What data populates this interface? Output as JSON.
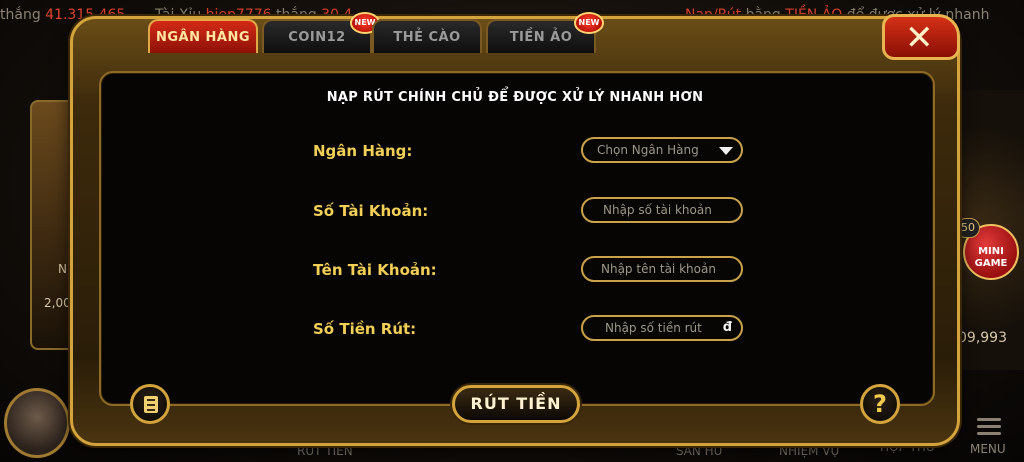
{
  "ticker": {
    "prefix_1": "thắng",
    "amount_1": "41.315.465",
    "game_2": "Tài Xỉu",
    "user_2": "hiep7776",
    "verb_2": "thắng",
    "amount_2": "30.4",
    "notice_a": "Nạp/Rút",
    "notice_b": "bằng",
    "notice_c": "TIỀN ẢO",
    "notice_d": "để được xử lý nhanh"
  },
  "background": {
    "left_card_label": "N",
    "left_card_value": "2,00",
    "mini_game_badge": "50",
    "mini_game_label": "MINI GAME",
    "right_money": "09,993",
    "bottom_items": [
      "RÚT TIỀN",
      "SĂN HŨ",
      "NHIỆM VỤ",
      "HỘP THƯ",
      "MENU"
    ]
  },
  "tabs": [
    {
      "label": "NGÂN HÀNG",
      "active": true,
      "new": false
    },
    {
      "label": "COIN12",
      "active": false,
      "new": true
    },
    {
      "label": "THẺ CÀO",
      "active": false,
      "new": false
    },
    {
      "label": "TIỀN ẢO",
      "active": false,
      "new": true
    }
  ],
  "new_badge_text": "NEW",
  "close_icon": "close-x-icon",
  "heading": "NẠP RÚT CHÍNH CHỦ ĐỂ ĐƯỢC XỬ LÝ NHANH HƠN",
  "form": {
    "bank": {
      "label": "Ngân Hàng:",
      "value": "Chọn Ngân Hàng"
    },
    "account_number": {
      "label": "Số Tài Khoản:",
      "placeholder": "Nhập số tài  khoản"
    },
    "account_name": {
      "label": "Tên Tài Khoản:",
      "placeholder": "Nhập tên tài khoản"
    },
    "amount": {
      "label": "Số Tiền Rút:",
      "placeholder": "Nhập số tiền rút",
      "currency": "đ"
    }
  },
  "withdraw_button": "RÚT TIỀN",
  "help_icon_text": "?",
  "colors": {
    "gold": "#d4a43c",
    "active_tab": "#c4200f",
    "label_yellow": "#f2cf56"
  }
}
